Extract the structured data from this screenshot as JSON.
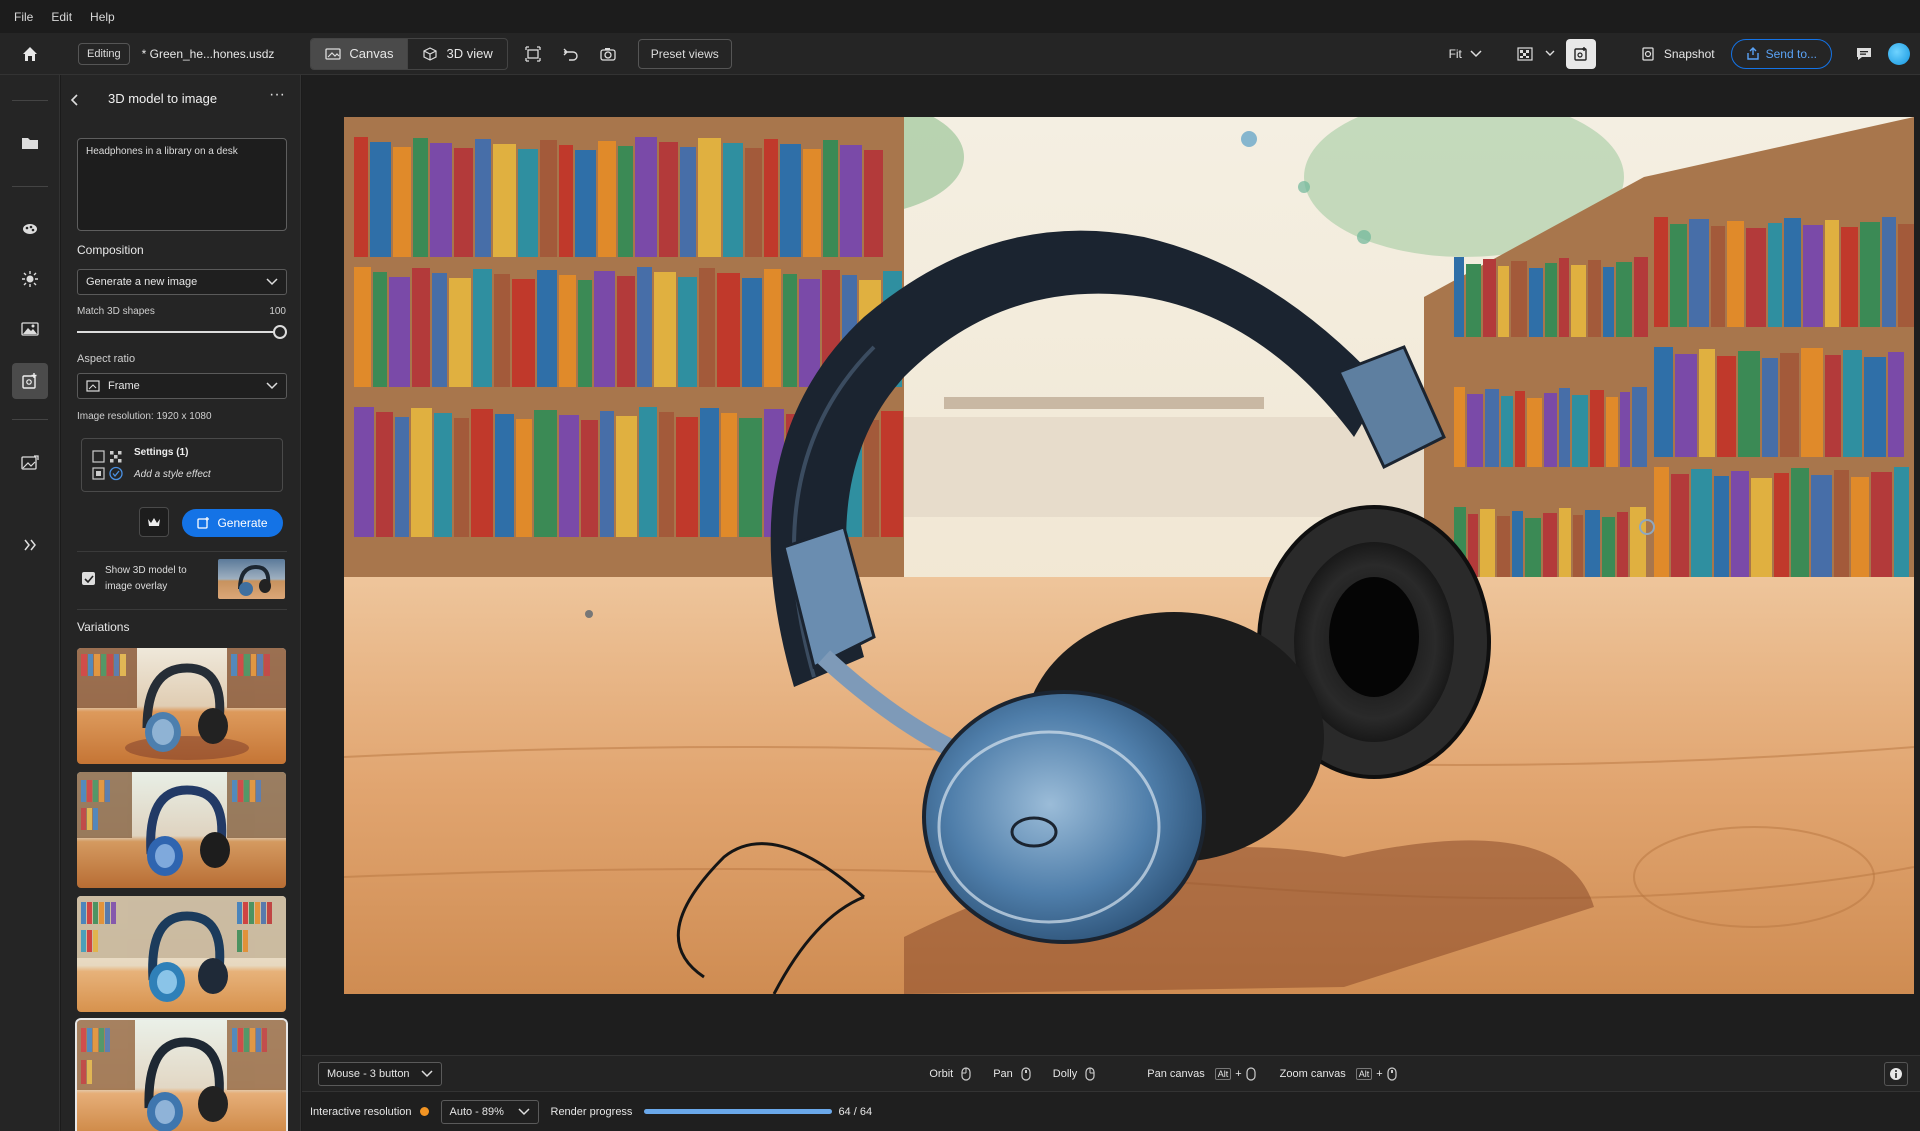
{
  "menu": [
    "File",
    "Edit",
    "Help"
  ],
  "toolbar": {
    "mode_badge": "Editing",
    "file_name": "* Green_he...hones.usdz",
    "canvas_label": "Canvas",
    "view3d_label": "3D view",
    "preset_views_label": "Preset views",
    "fit_label": "Fit",
    "snapshot_label": "Snapshot",
    "send_label": "Send to..."
  },
  "panel": {
    "title": "3D model to image",
    "prompt_text": "Headphones in a library on a desk",
    "composition_label": "Composition",
    "composition_value": "Generate a new image",
    "match_label": "Match 3D shapes",
    "match_value": "100",
    "match_level": 1.0,
    "aspect_label": "Aspect ratio",
    "aspect_value": "Frame",
    "resolution_text": "Image resolution: 1920 x 1080",
    "settings_label": "Settings (1)",
    "style_effect_label": "Add a style effect",
    "generate_label": "Generate",
    "overlay_label_1": "Show 3D model to",
    "overlay_label_2": "image overlay",
    "variations_label": "Variations"
  },
  "bottom": {
    "mouse_mode": "Mouse - 3 button",
    "orbit": "Orbit",
    "pan": "Pan",
    "dolly": "Dolly",
    "pan_canvas": "Pan canvas",
    "zoom_canvas": "Zoom canvas",
    "alt_key": "Alt",
    "plus": "+"
  },
  "status": {
    "interactive_label": "Interactive resolution",
    "resolution_value": "Auto - 89%",
    "render_label": "Render progress",
    "render_count": "64 / 64",
    "render_fraction": 1.0
  },
  "colors": {
    "accent": "#1473e6",
    "status_dot": "#f29423",
    "avatar": "#1fa3e6"
  }
}
